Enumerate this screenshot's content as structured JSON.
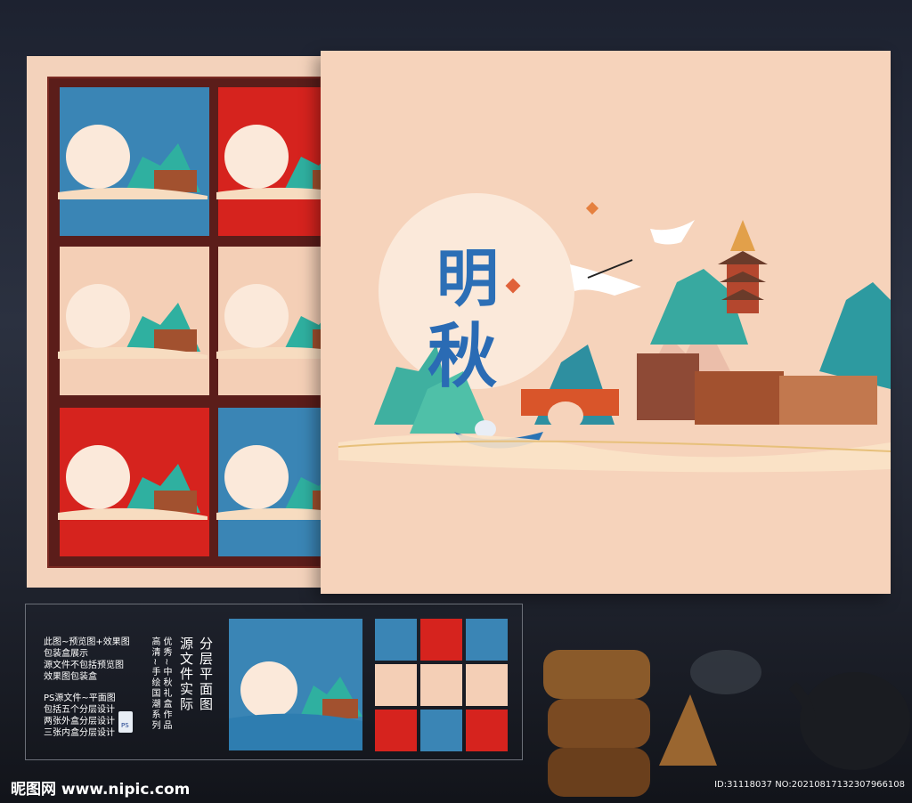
{
  "info": {
    "lines": [
      "此图~预览图+效果图",
      "包装盒展示",
      "源文件不包括预览图",
      "效果图包装盒"
    ],
    "ps_lines": [
      "PS源文件~平面图",
      "包括五个分层设计",
      "两张外盒分层设计",
      "三张内盒分层设计"
    ],
    "ps_badge": "PS",
    "vertical_small": [
      "优秀~中秋礼盒作品",
      "高清~手绘国潮系列"
    ],
    "vertical_large": [
      "分层平面图",
      "源文件实际"
    ]
  },
  "watermark": "昵图网 www.nipic.com",
  "image_id": "ID:31118037 NO:20210817132307966108",
  "colors": {
    "blue": "#3b86b5",
    "red": "#d42520",
    "peach": "#f4cfb6",
    "frame": "#5b1d1a"
  },
  "icons": [
    "moon-illustration",
    "crane-icon",
    "pagoda-icon",
    "mountain-icon",
    "bridge-icon",
    "boat-icon",
    "rabbit-icon",
    "mooncake-icon",
    "teapot-icon"
  ]
}
